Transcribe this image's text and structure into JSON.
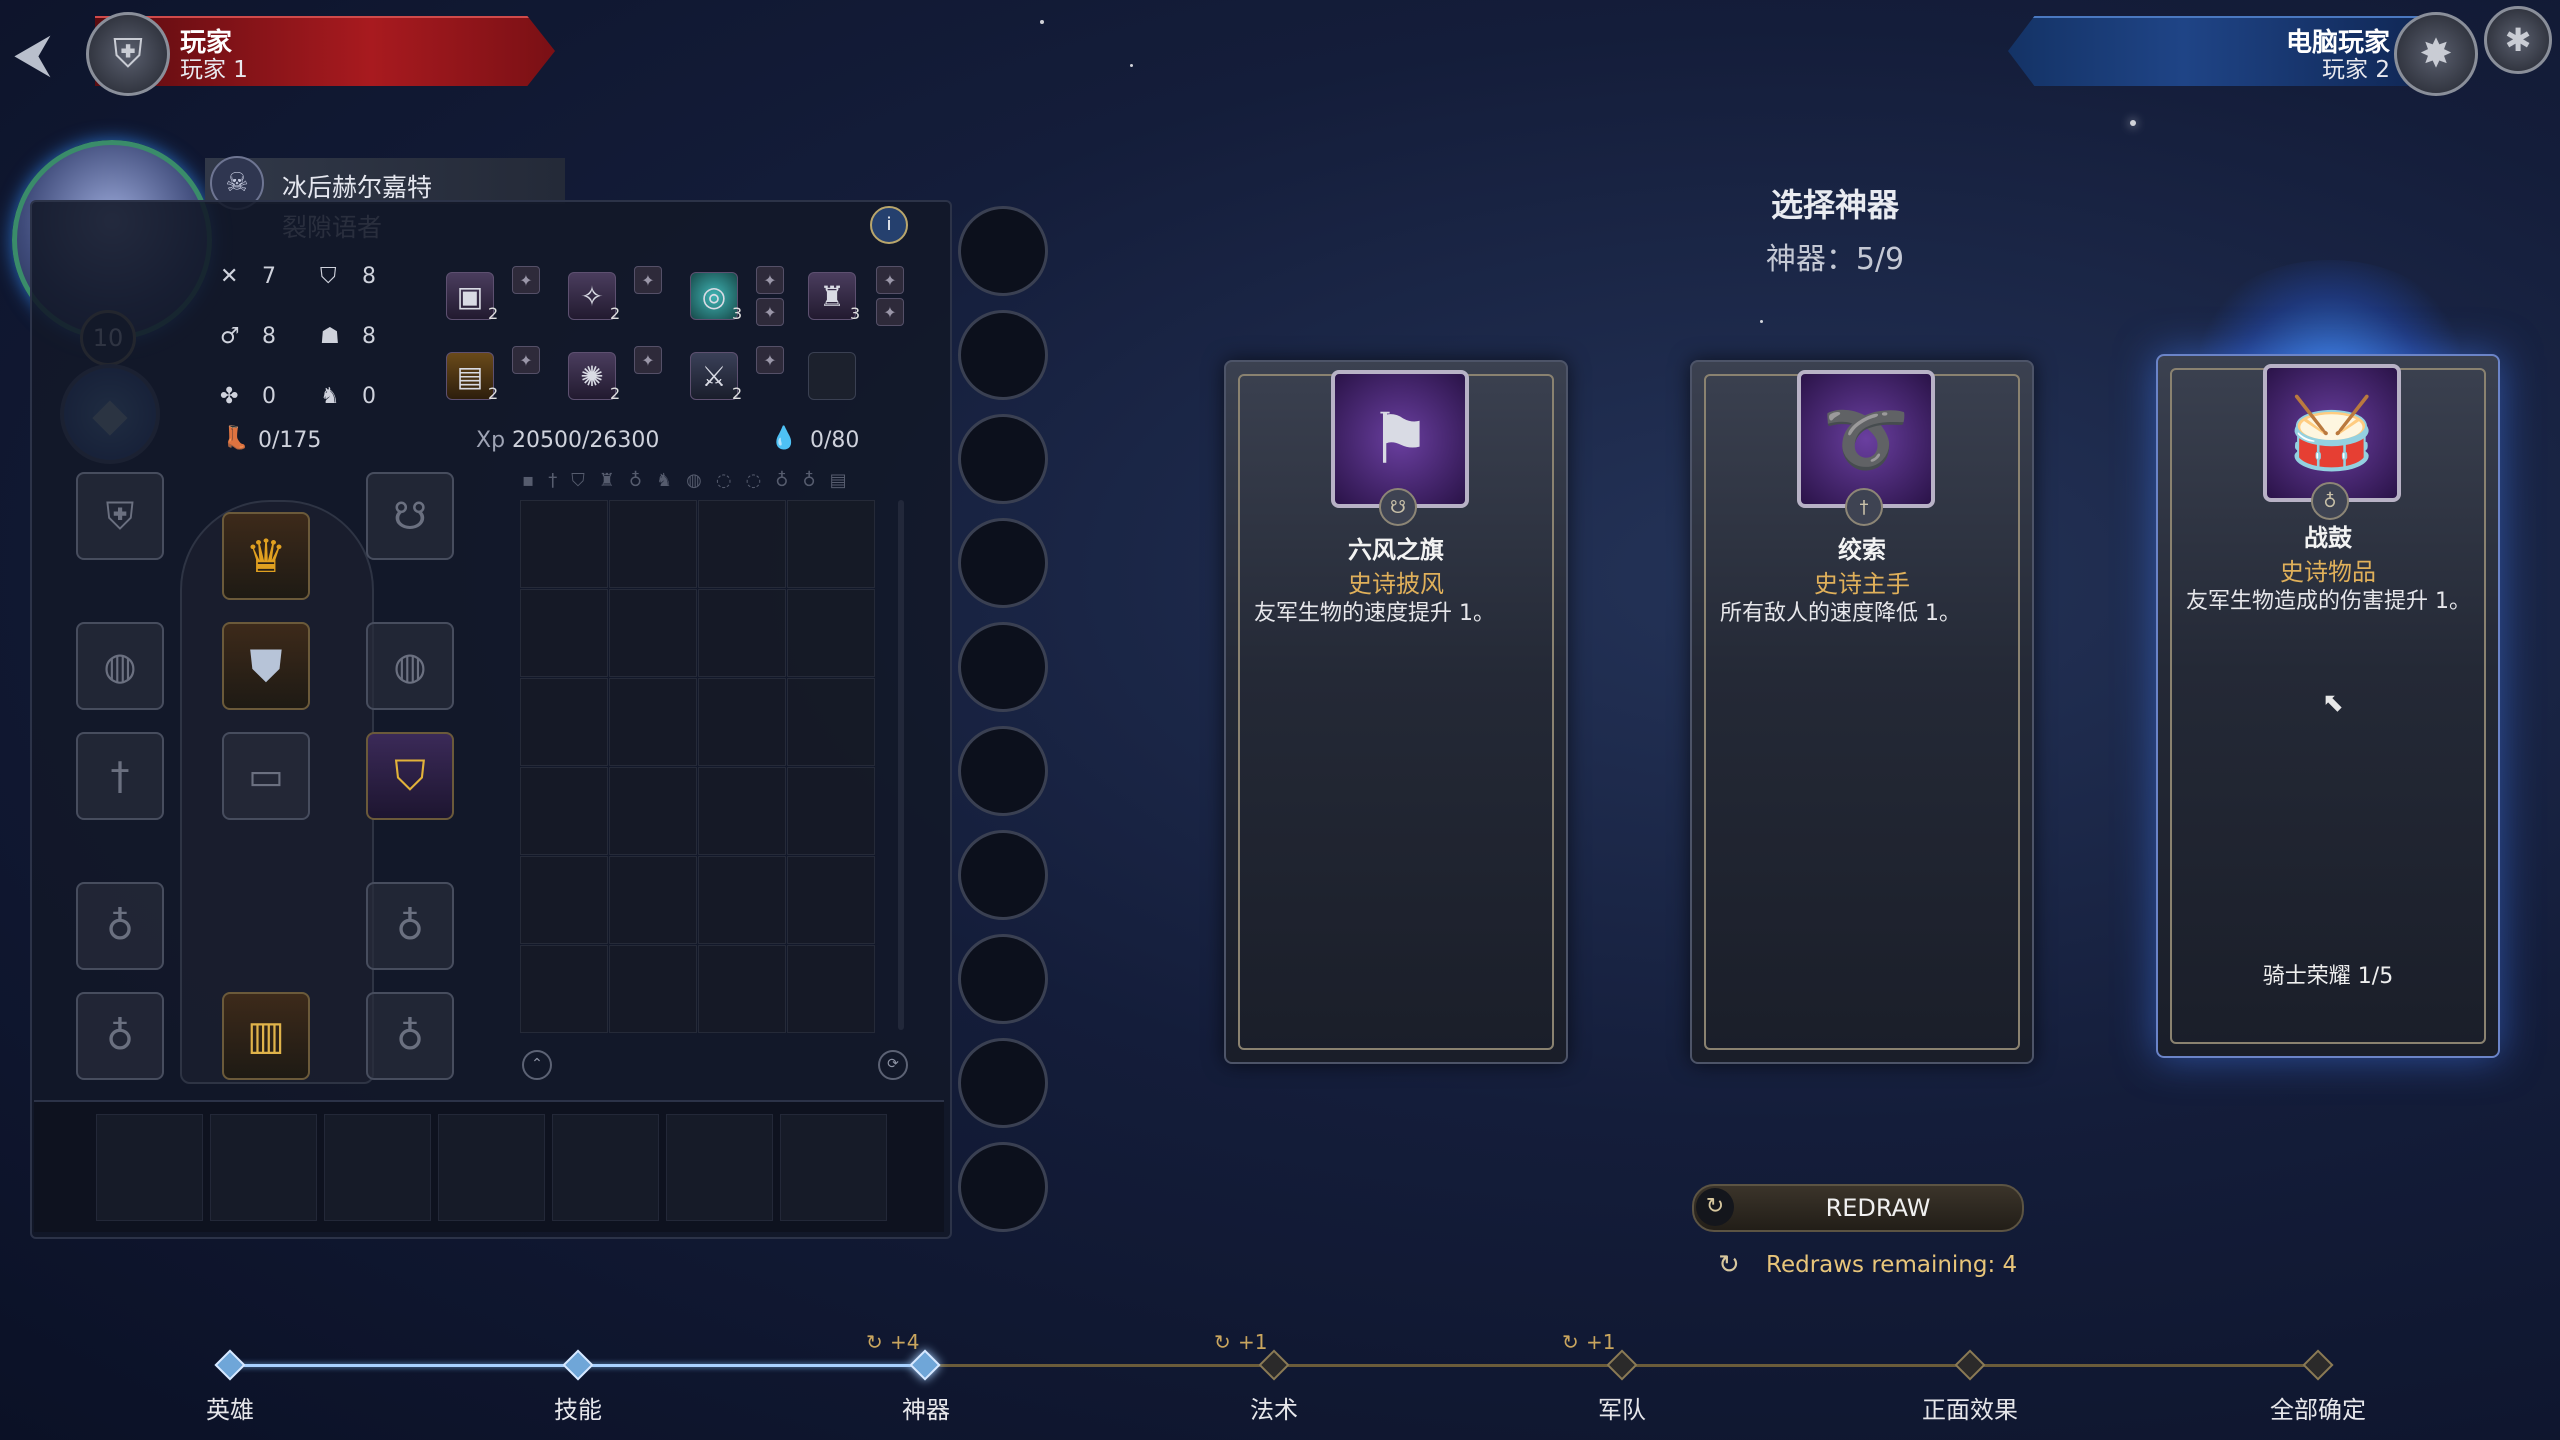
{
  "top_bar": {
    "player_left": {
      "name": "玩家",
      "sub": "玩家 1",
      "emblem_icon": "helmet-emblem"
    },
    "player_right": {
      "name": "电脑玩家",
      "sub": "玩家 2",
      "emblem_icon": "beast-emblem"
    },
    "back_icon": "back-arrow-icon",
    "settings_icon": "bug-settings-icon"
  },
  "hero": {
    "name": "冰后赫尔嘉特",
    "class": "裂隙语者",
    "level": "10",
    "stats": [
      {
        "icon": "attack-icon",
        "value": "7"
      },
      {
        "icon": "defense-icon",
        "value": "8"
      },
      {
        "icon": "power-icon",
        "value": "8"
      },
      {
        "icon": "knowledge-icon",
        "value": "8"
      },
      {
        "icon": "luck-icon",
        "value": "0"
      },
      {
        "icon": "morale-icon",
        "value": "0"
      }
    ],
    "movement": "0/175",
    "xp_label": "Xp",
    "xp": "20500/26300",
    "mana": "0/80",
    "artifact_counts": [
      "2",
      "2",
      "3",
      "3",
      "2",
      "2",
      "2"
    ]
  },
  "artifact_select": {
    "title": "选择神器",
    "count": "神器：5/9",
    "cards": [
      {
        "name": "六风之旗",
        "type": "史诗披风",
        "desc": "友军生物的速度提升 1。",
        "footer": "",
        "icon": "banner-icon",
        "slot_icon": "cloak-slot-icon"
      },
      {
        "name": "绞索",
        "type": "史诗主手",
        "desc": "所有敌人的速度降低 1。",
        "footer": "",
        "icon": "noose-icon",
        "slot_icon": "weapon-slot-icon"
      },
      {
        "name": "战鼓",
        "type": "史诗物品",
        "desc": "友军生物造成的伤害提升 1。",
        "footer": "骑士荣耀 1/5",
        "icon": "war-drum-icon",
        "slot_icon": "item-slot-icon"
      }
    ],
    "redraw_label": "REDRAW",
    "redraws_remaining": "Redraws remaining: 4"
  },
  "timeline": {
    "steps": [
      {
        "label": "英雄",
        "bonus": ""
      },
      {
        "label": "技能",
        "bonus": ""
      },
      {
        "label": "神器",
        "bonus": "+4"
      },
      {
        "label": "法术",
        "bonus": "+1"
      },
      {
        "label": "军队",
        "bonus": "+1"
      },
      {
        "label": "正面效果",
        "bonus": ""
      },
      {
        "label": "全部确定",
        "bonus": ""
      }
    ],
    "current_step": 2
  },
  "colors": {
    "accent_gold": "#e0b05a",
    "player_red": "#a81a1f",
    "ai_blue": "#1f4486",
    "progress_blue": "#a9d2ff"
  }
}
